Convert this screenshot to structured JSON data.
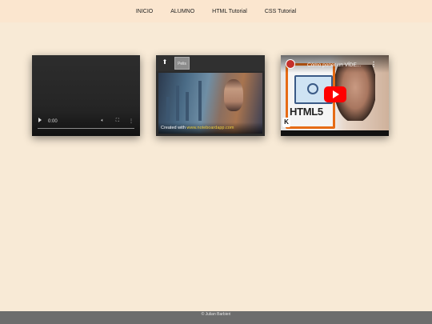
{
  "nav": {
    "items": [
      "INICIO",
      "ALUMNO",
      "HTML Tutorial",
      "CSS Tutorial"
    ]
  },
  "video_player": {
    "time": "0:00",
    "icons": [
      "play-icon",
      "volume-icon",
      "fullscreen-icon",
      "more-options-icon"
    ],
    "progress": 0
  },
  "noteboard": {
    "up_icon": "arrow-up-icon",
    "tab_label": "Pelis",
    "caption_prefix": "Created with ",
    "caption_link": "www.noteboardapp.com"
  },
  "youtube": {
    "title": "Cómo poner un VÍDE...",
    "overlay_text": "HTML5",
    "icons": [
      "channel-avatar",
      "more-vert-icon",
      "youtube-play-icon",
      "logo-k-icon"
    ]
  },
  "footer": {
    "text": "© Julian Barbieri"
  },
  "colors": {
    "page_bg": "#f8ead6",
    "nav_bg": "#fbe6cf",
    "footer_bg": "#6d6d6d",
    "accent_orange": "#e66b15",
    "youtube_red": "#ff0000"
  }
}
